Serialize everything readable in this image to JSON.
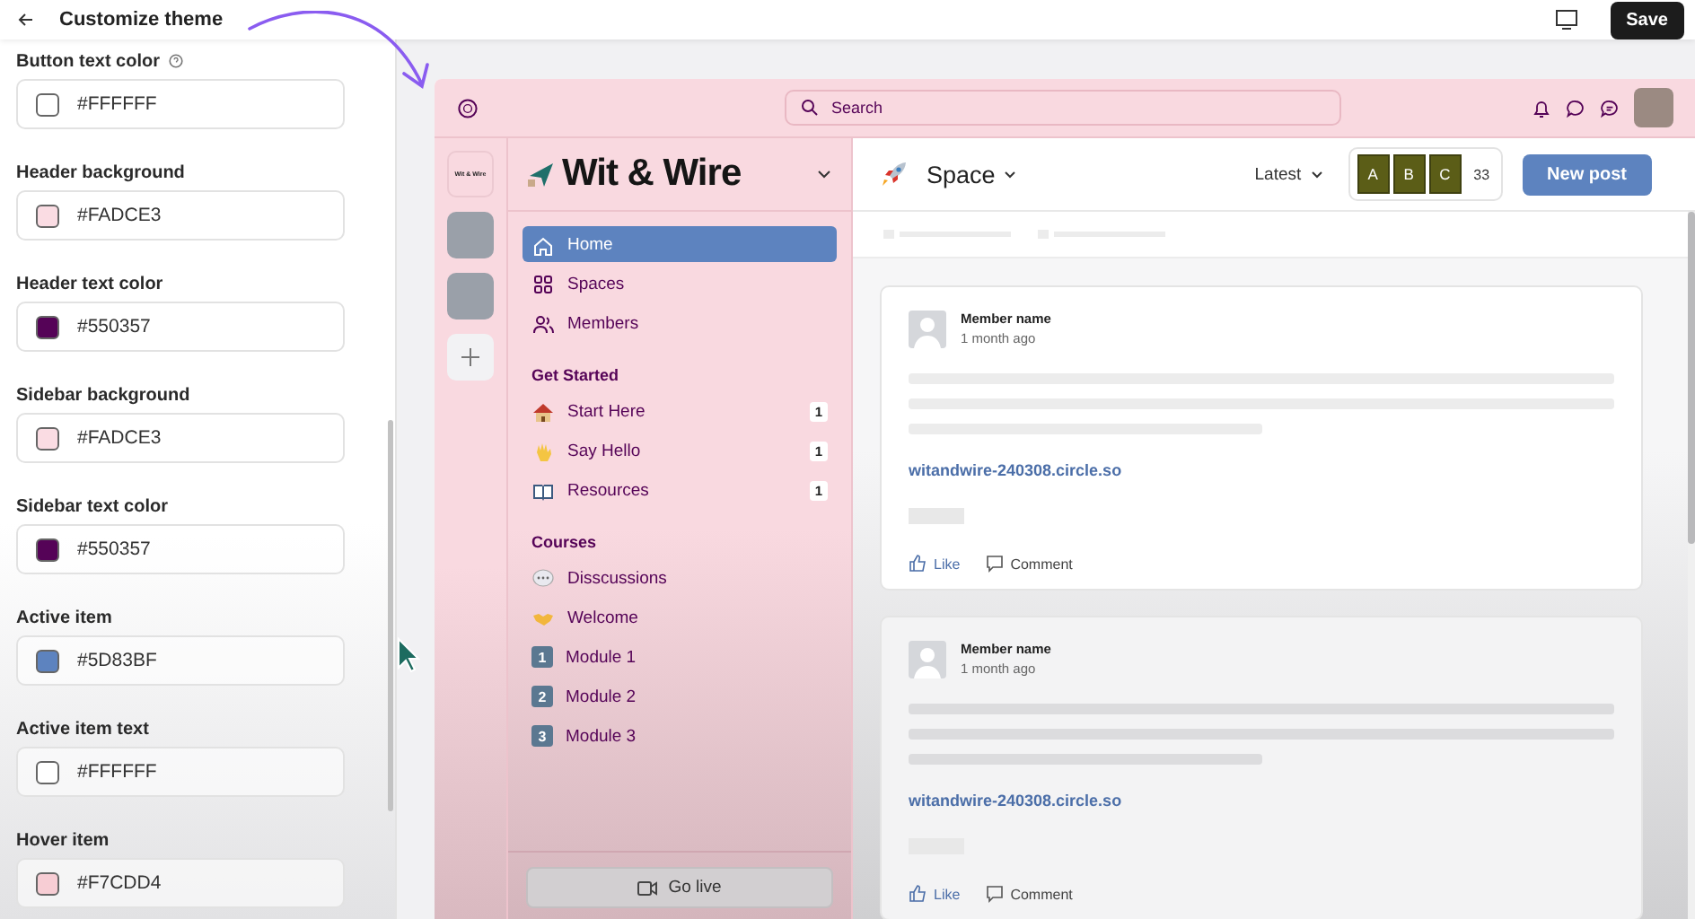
{
  "topbar": {
    "title": "Customize theme",
    "save": "Save"
  },
  "settings": [
    {
      "label": "Button text color",
      "help": true,
      "value": "#FFFFFF",
      "color": "#ffffff"
    },
    {
      "label": "Header background",
      "help": false,
      "value": "#FADCE3",
      "color": "#fadce3"
    },
    {
      "label": "Header text color",
      "help": false,
      "value": "#550357",
      "color": "#550357"
    },
    {
      "label": "Sidebar background",
      "help": false,
      "value": "#FADCE3",
      "color": "#fadce3"
    },
    {
      "label": "Sidebar text color",
      "help": false,
      "value": "#550357",
      "color": "#550357"
    },
    {
      "label": "Active item",
      "help": false,
      "value": "#5D83BF",
      "color": "#5d83bf"
    },
    {
      "label": "Active item text",
      "help": false,
      "value": "#FFFFFF",
      "color": "#ffffff"
    },
    {
      "label": "Hover item",
      "help": false,
      "value": "#F7CDD4",
      "color": "#f7cdd4"
    }
  ],
  "preview": {
    "search": {
      "placeholder": "Search"
    },
    "rail_label": "Wit & Wire",
    "community_name": "Wit & Wire",
    "nav": [
      {
        "label": "Home",
        "kind": "home",
        "selected": true
      },
      {
        "label": "Spaces",
        "kind": "grid",
        "selected": false
      },
      {
        "label": "Members",
        "kind": "people",
        "selected": false
      }
    ],
    "sections": [
      {
        "title": "Get Started",
        "items": [
          {
            "label": "Start Here",
            "kind": "house",
            "badge": "1"
          },
          {
            "label": "Say Hello",
            "kind": "hand",
            "badge": "1"
          },
          {
            "label": "Resources",
            "kind": "book",
            "badge": "1"
          }
        ]
      },
      {
        "title": "Courses",
        "items": [
          {
            "label": "Disscussions",
            "kind": "speech"
          },
          {
            "label": "Welcome",
            "kind": "handshake"
          },
          {
            "label": "Module 1",
            "kind": "keycap",
            "key": "1"
          },
          {
            "label": "Module 2",
            "kind": "keycap",
            "key": "2"
          },
          {
            "label": "Module 3",
            "kind": "keycap",
            "key": "3"
          }
        ]
      }
    ],
    "go_live": "Go live",
    "space_title": "Space",
    "sort": "Latest",
    "avatars": [
      "A",
      "B",
      "C"
    ],
    "member_count": "33",
    "new_post": "New post",
    "posts": [
      {
        "author": "Member name",
        "time": "1 month ago",
        "link": "witandwire-240308.circle.so",
        "like": "Like",
        "comment": "Comment"
      },
      {
        "author": "Member name",
        "time": "1 month ago",
        "link": "witandwire-240308.circle.so",
        "like": "Like",
        "comment": "Comment"
      }
    ]
  }
}
